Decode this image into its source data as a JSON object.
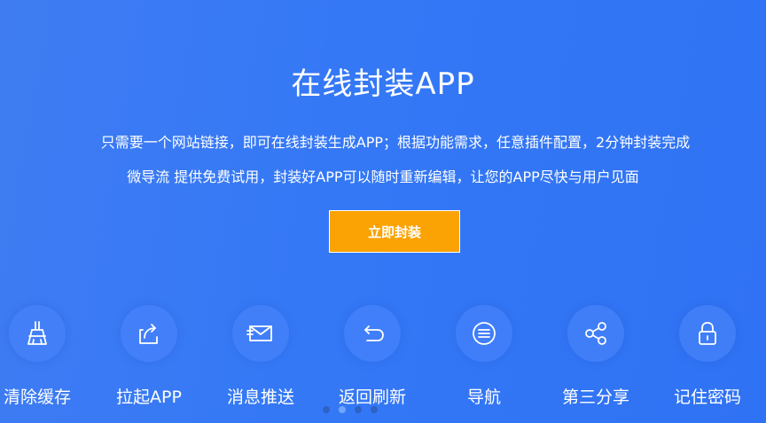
{
  "hero": {
    "title": "在线封装APP",
    "desc_line1": "只需要一个网站链接，即可在线封装生成APP；根据功能需求，任意插件配置，2分钟封装完成",
    "desc_line2": "微导流 提供免费试用，封装好APP可以随时重新编辑，让您的APP尽快与用户见面",
    "cta_label": "立即封装",
    "cta_color": "#fba304"
  },
  "features": [
    {
      "label": "清除缓存",
      "icon": "broom-icon"
    },
    {
      "label": "拉起APP",
      "icon": "launch-app-icon"
    },
    {
      "label": "消息推送",
      "icon": "message-icon"
    },
    {
      "label": "返回刷新",
      "icon": "back-refresh-icon"
    },
    {
      "label": "导航",
      "icon": "menu-icon"
    },
    {
      "label": "第三分享",
      "icon": "share-icon"
    },
    {
      "label": "记住密码",
      "icon": "lock-icon"
    }
  ],
  "carousel": {
    "active_index": 1,
    "count": 4
  },
  "colors": {
    "background": "#3478f6",
    "accent": "#fba304"
  }
}
